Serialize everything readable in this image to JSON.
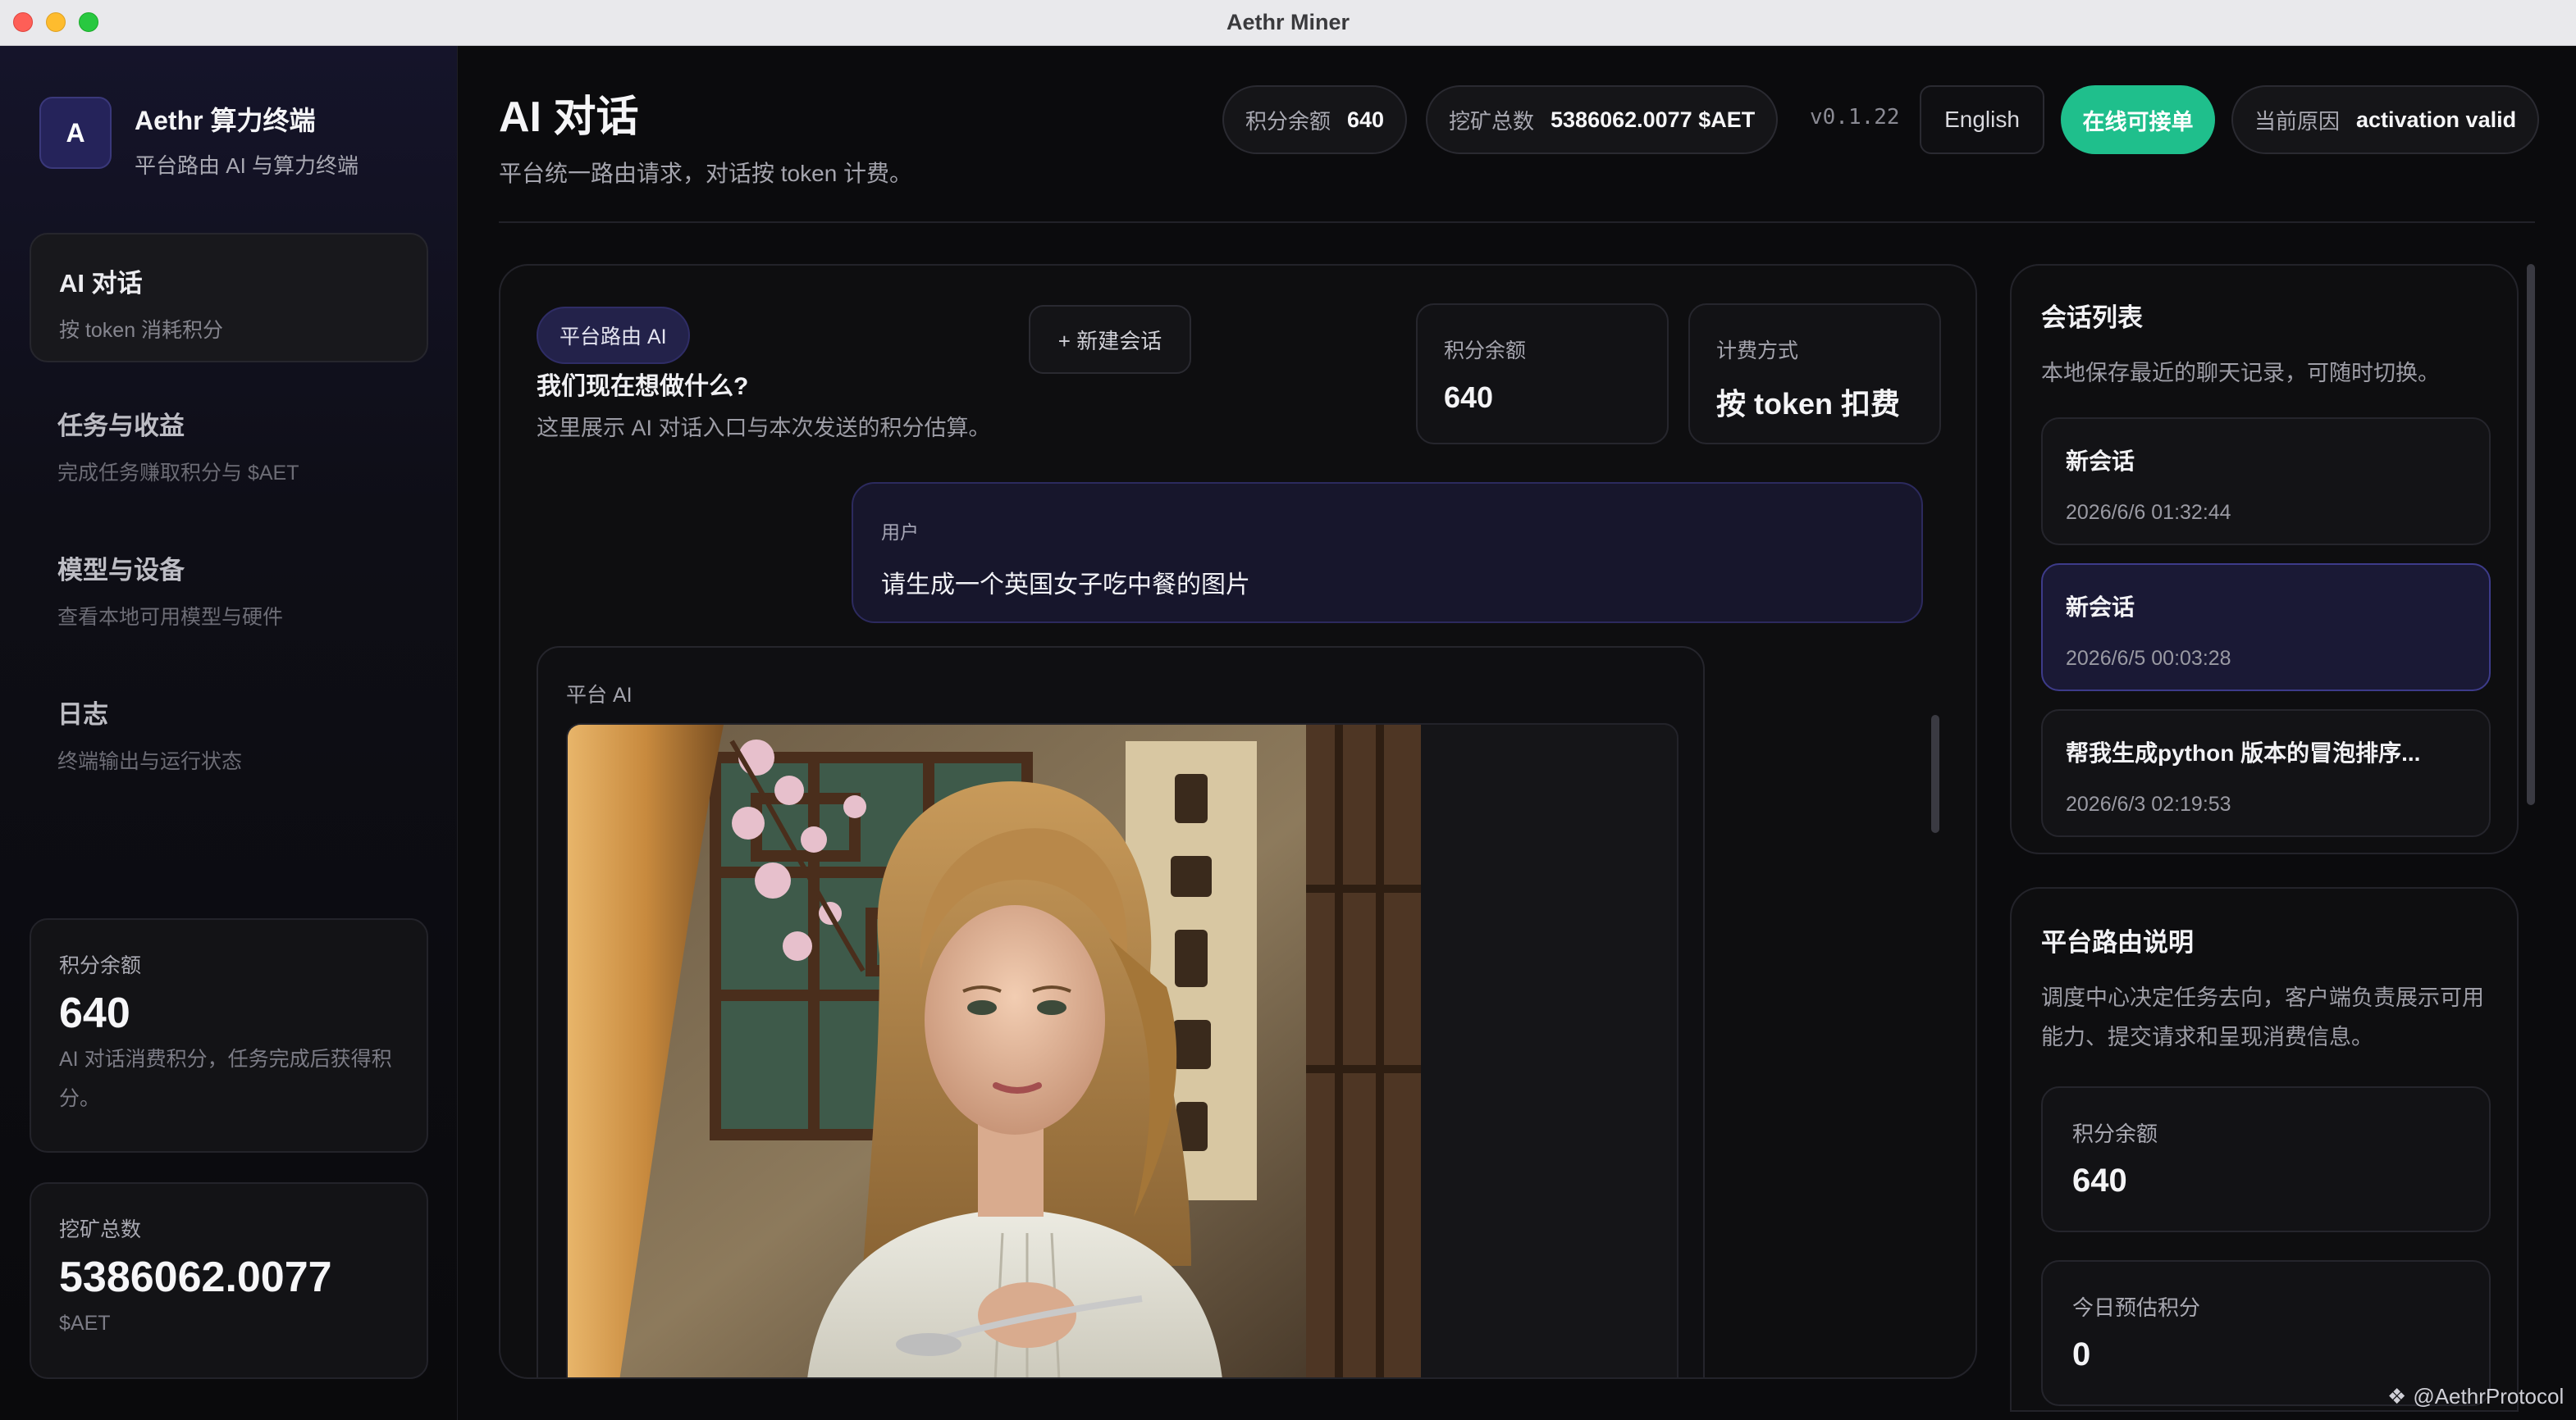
{
  "window": {
    "title": "Aethr Miner"
  },
  "brand": {
    "initial": "A",
    "name": "Aethr 算力终端",
    "subtitle": "平台路由 AI 与算力终端"
  },
  "nav": [
    {
      "label": "AI 对话",
      "sub": "按 token 消耗积分",
      "active": true
    },
    {
      "label": "任务与收益",
      "sub": "完成任务赚取积分与 $AET",
      "active": false
    },
    {
      "label": "模型与设备",
      "sub": "查看本地可用模型与硬件",
      "active": false
    },
    {
      "label": "日志",
      "sub": "终端输出与运行状态",
      "active": false
    }
  ],
  "sidebar_cards": {
    "points": {
      "label": "积分余额",
      "value": "640",
      "desc": "AI 对话消费积分，任务完成后获得积分。"
    },
    "mined": {
      "label": "挖矿总数",
      "value": "5386062.0077",
      "unit": "$AET"
    }
  },
  "header": {
    "title": "AI 对话",
    "subtitle": "平台统一路由请求，对话按 token 计费。",
    "points_label": "积分余额",
    "points_value": "640",
    "mined_label": "挖矿总数",
    "mined_value": "5386062.0077 $AET",
    "version": "v0.1.22",
    "language_button": "English",
    "online_button": "在线可接单",
    "reason_label": "当前原因",
    "reason_value": "activation valid"
  },
  "chat": {
    "route_badge": "平台路由 AI",
    "new_chat_button": "+ 新建会话",
    "heading": "我们现在想做什么?",
    "description": "这里展示 AI 对话入口与本次发送的积分估算。",
    "stats": [
      {
        "label": "积分余额",
        "value": "640"
      },
      {
        "label": "计费方式",
        "value": "按 token 扣费"
      }
    ],
    "messages": [
      {
        "role": "用户",
        "text": "请生成一个英国女子吃中餐的图片"
      },
      {
        "role": "平台 AI",
        "image": "generated-image: woman-eating-chinese-food"
      }
    ]
  },
  "sessions": {
    "title": "会话列表",
    "description": "本地保存最近的聊天记录，可随时切换。",
    "items": [
      {
        "title": "新会话",
        "time": "2026/6/6 01:32:44",
        "active": false
      },
      {
        "title": "新会话",
        "time": "2026/6/5 00:03:28",
        "active": true
      },
      {
        "title": "帮我生成python 版本的冒泡排序...",
        "time": "2026/6/3 02:19:53",
        "active": false
      }
    ]
  },
  "route_info": {
    "title": "平台路由说明",
    "description": "调度中心决定任务去向，客户端负责展示可用能力、提交请求和呈现消费信息。",
    "cards": [
      {
        "label": "积分余额",
        "value": "640"
      },
      {
        "label": "今日预估积分",
        "value": "0"
      }
    ]
  },
  "watermark": "@AethrProtocol",
  "colors": {
    "accent": "#1fbf8c",
    "active_border": "#3d3b8a",
    "background": "#0b0b0d"
  }
}
